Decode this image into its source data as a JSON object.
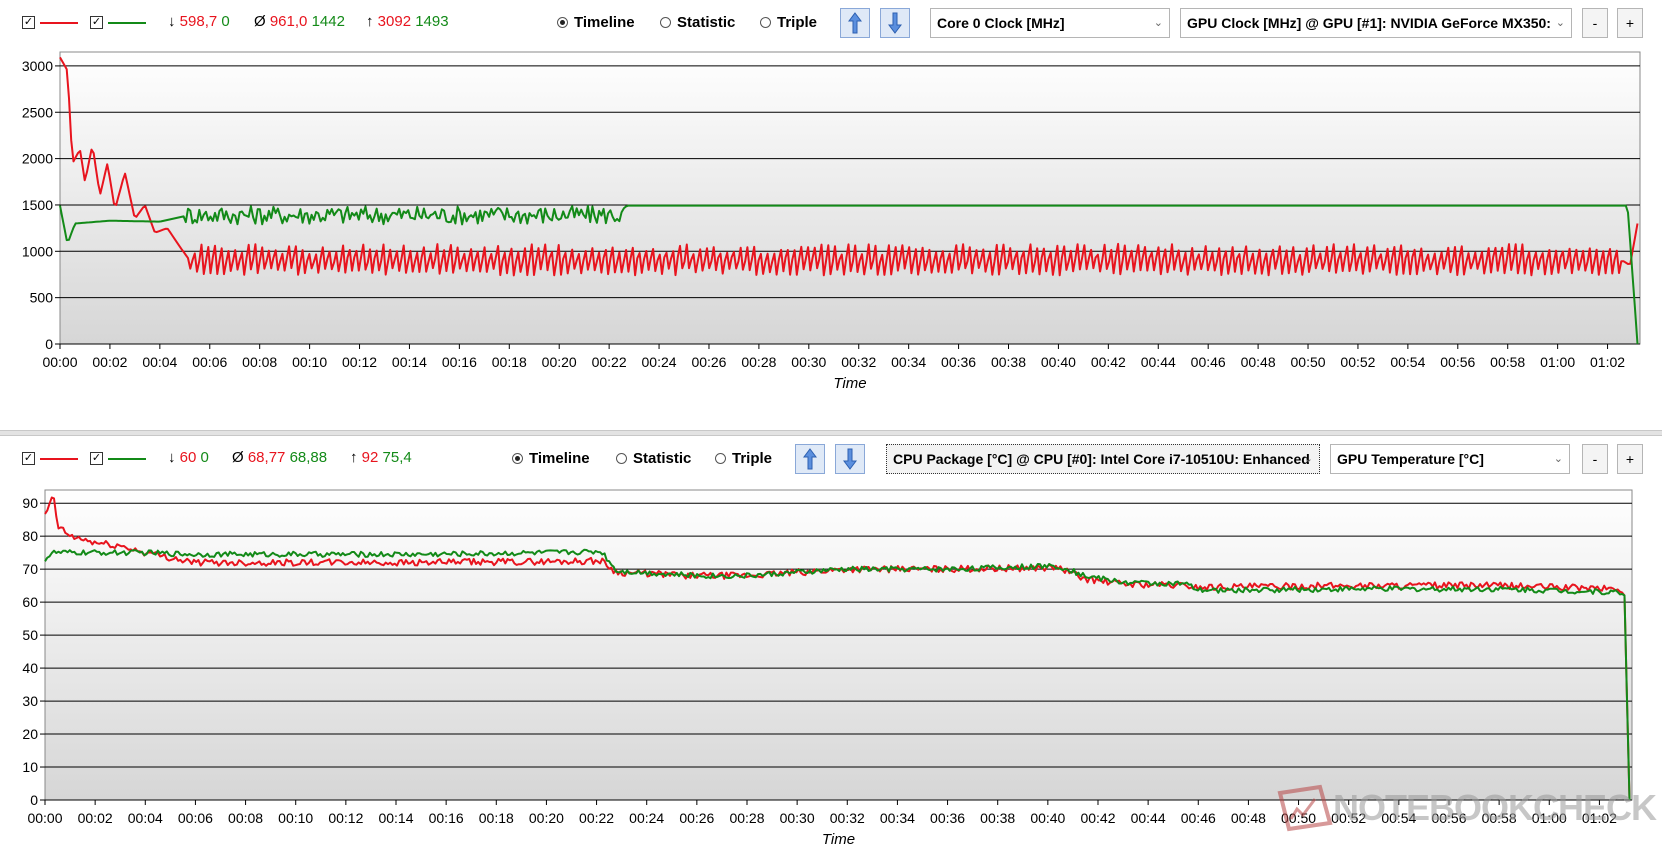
{
  "panels": [
    {
      "series_a_color": "#e8141e",
      "series_b_color": "#138a18",
      "stats": {
        "min_label": "↓",
        "min_a": "598,7",
        "min_b": "0",
        "avg_label": "Ø",
        "avg_a": "961,0",
        "avg_b": "1442",
        "max_label": "↑",
        "max_a": "3092",
        "max_b": "1493"
      },
      "modes": [
        "Timeline",
        "Statistic",
        "Triple"
      ],
      "selected_mode": "Timeline",
      "select_a": "Core 0 Clock [MHz]",
      "select_b": "GPU Clock [MHz] @ GPU [#1]: NVIDIA GeForce MX350:",
      "minus_label": "-",
      "plus_label": "+",
      "x_axis_title": "Time"
    },
    {
      "series_a_color": "#e8141e",
      "series_b_color": "#138a18",
      "stats": {
        "min_label": "↓",
        "min_a": "60",
        "min_b": "0",
        "avg_label": "Ø",
        "avg_a": "68,77",
        "avg_b": "68,88",
        "max_label": "↑",
        "max_a": "92",
        "max_b": "75,4"
      },
      "modes": [
        "Timeline",
        "Statistic",
        "Triple"
      ],
      "selected_mode": "Timeline",
      "select_a": "CPU Package [°C] @ CPU [#0]: Intel Core i7-10510U: Enhanced",
      "select_b": "GPU Temperature [°C]",
      "minus_label": "-",
      "plus_label": "+",
      "x_axis_title": "Time"
    }
  ],
  "chart_data": [
    {
      "type": "line",
      "xlabel": "Time",
      "x_ticks": [
        "00:00",
        "00:02",
        "00:04",
        "00:06",
        "00:08",
        "00:10",
        "00:12",
        "00:14",
        "00:16",
        "00:18",
        "00:20",
        "00:22",
        "00:24",
        "00:26",
        "00:28",
        "00:30",
        "00:32",
        "00:34",
        "00:36",
        "00:38",
        "00:40",
        "00:42",
        "00:44",
        "00:46",
        "00:48",
        "00:50",
        "00:52",
        "00:54",
        "00:56",
        "00:58",
        "01:00",
        "01:02"
      ],
      "xlim_minutes": [
        0,
        63.3
      ],
      "y_ticks": [
        0,
        500,
        1000,
        1500,
        2000,
        2500,
        3000
      ],
      "ylim": [
        0,
        3150
      ],
      "grid": true,
      "series": [
        {
          "color": "#e8141e",
          "points": [
            [
              0,
              3092
            ],
            [
              0.3,
              2950
            ],
            [
              0.5,
              1950
            ],
            [
              0.8,
              2100
            ],
            [
              1.0,
              1750
            ],
            [
              1.3,
              2150
            ],
            [
              1.6,
              1600
            ],
            [
              1.9,
              1950
            ],
            [
              2.2,
              1450
            ],
            [
              2.6,
              1850
            ],
            [
              3.0,
              1350
            ],
            [
              3.4,
              1500
            ],
            [
              3.8,
              1200
            ],
            [
              4.3,
              1250
            ],
            [
              4.8,
              1050
            ],
            [
              5.2,
              900
            ],
            [
              22.8,
              900
            ],
            [
              62.6,
              900
            ],
            [
              62.9,
              850
            ],
            [
              63.2,
              1300
            ]
          ],
          "oscillation": {
            "from": 5.2,
            "to": 62.6,
            "low": 740,
            "high": 1080
          }
        },
        {
          "color": "#138a18",
          "points": [
            [
              0,
              1493
            ],
            [
              0.3,
              1080
            ],
            [
              0.6,
              1300
            ],
            [
              2,
              1330
            ],
            [
              4,
              1320
            ],
            [
              5,
              1380
            ],
            [
              6,
              1400
            ],
            [
              10,
              1400
            ],
            [
              15,
              1420
            ],
            [
              20,
              1410
            ],
            [
              22.6,
              1450
            ],
            [
              22.7,
              1493
            ],
            [
              62.8,
              1493
            ],
            [
              63.2,
              0
            ]
          ],
          "oscillation": {
            "from": 5.0,
            "to": 22.6,
            "low": 1290,
            "high": 1493
          }
        }
      ]
    },
    {
      "type": "line",
      "xlabel": "Time",
      "x_ticks": [
        "00:00",
        "00:02",
        "00:04",
        "00:06",
        "00:08",
        "00:10",
        "00:12",
        "00:14",
        "00:16",
        "00:18",
        "00:20",
        "00:22",
        "00:24",
        "00:26",
        "00:28",
        "00:30",
        "00:32",
        "00:34",
        "00:36",
        "00:38",
        "00:40",
        "00:42",
        "00:44",
        "00:46",
        "00:48",
        "00:50",
        "00:52",
        "00:54",
        "00:56",
        "00:58",
        "01:00",
        "01:02"
      ],
      "xlim_minutes": [
        0,
        63.3
      ],
      "y_ticks": [
        0,
        10,
        20,
        30,
        40,
        50,
        60,
        70,
        80,
        90
      ],
      "ylim": [
        0,
        94
      ],
      "grid": true,
      "series": [
        {
          "color": "#e8141e",
          "points": [
            [
              0,
              86
            ],
            [
              0.2,
              90
            ],
            [
              0.35,
              92
            ],
            [
              0.5,
              83
            ],
            [
              1,
              80
            ],
            [
              2,
              78
            ],
            [
              3,
              77
            ],
            [
              4,
              75
            ],
            [
              5,
              73.5
            ],
            [
              6,
              72
            ],
            [
              10,
              72
            ],
            [
              15,
              72
            ],
            [
              20,
              72.3
            ],
            [
              22.2,
              72.5
            ],
            [
              22.8,
              69
            ],
            [
              26,
              68
            ],
            [
              28,
              68
            ],
            [
              32,
              70
            ],
            [
              36,
              70
            ],
            [
              40.4,
              70.5
            ],
            [
              41.5,
              67
            ],
            [
              43,
              65.5
            ],
            [
              45.5,
              65
            ],
            [
              46,
              64.5
            ],
            [
              52,
              65
            ],
            [
              58,
              65
            ],
            [
              62.8,
              64
            ],
            [
              63,
              62
            ],
            [
              63.2,
              0
            ]
          ],
          "noise": 1.0
        },
        {
          "color": "#138a18",
          "points": [
            [
              0,
              73
            ],
            [
              0.3,
              75
            ],
            [
              2,
              75
            ],
            [
              4,
              75
            ],
            [
              6,
              74.5
            ],
            [
              10,
              74.5
            ],
            [
              15,
              74.5
            ],
            [
              20,
              75
            ],
            [
              22.2,
              75.4
            ],
            [
              22.8,
              69.5
            ],
            [
              26,
              68
            ],
            [
              28,
              68
            ],
            [
              32,
              70
            ],
            [
              36,
              70
            ],
            [
              40.4,
              71
            ],
            [
              41.5,
              68
            ],
            [
              43,
              66
            ],
            [
              45.5,
              65.5
            ],
            [
              46,
              63.5
            ],
            [
              52,
              64
            ],
            [
              58,
              64
            ],
            [
              62.8,
              63
            ],
            [
              63,
              62
            ],
            [
              63.2,
              0
            ]
          ],
          "noise": 0.8
        }
      ]
    }
  ],
  "watermark": {
    "text": "NOTEBOOKCHECK",
    "icon": "notebookcheck-logo-icon"
  }
}
